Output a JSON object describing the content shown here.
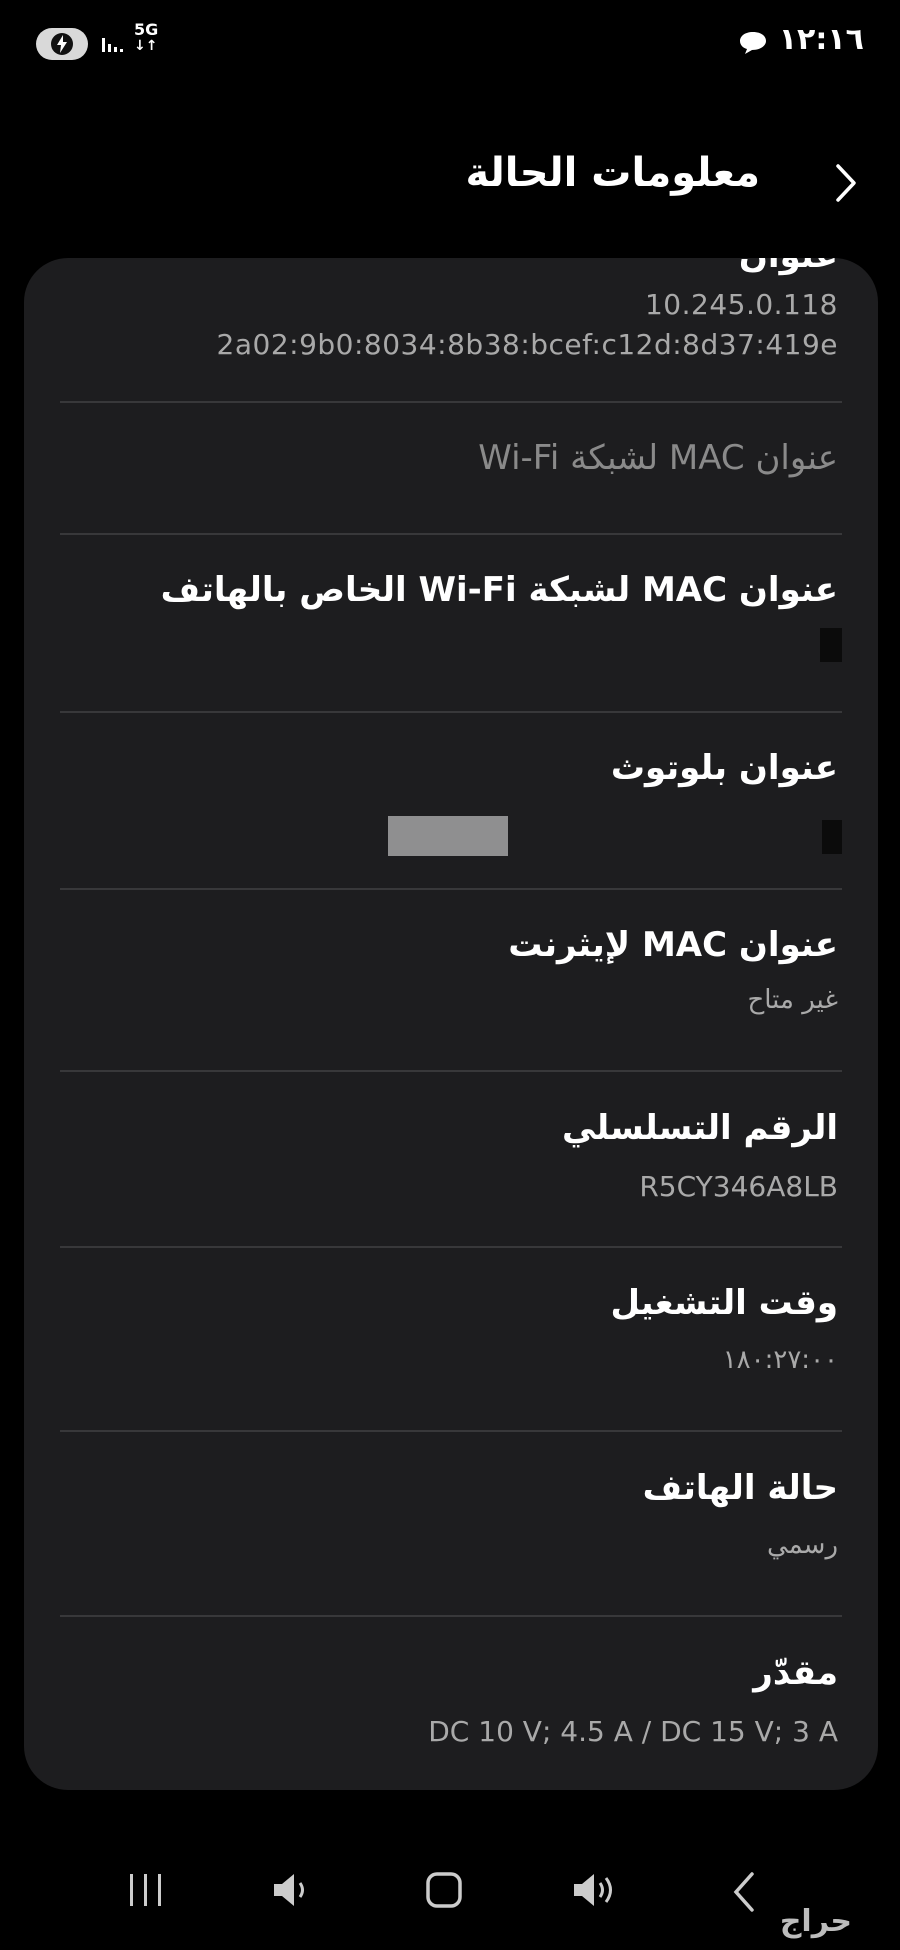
{
  "status_bar": {
    "time": "١٢:١٦",
    "network": "5G",
    "network_arrows": "↓↑",
    "battery_icon": "charging-battery-icon",
    "chat_icon": "chat-bubble-icon",
    "signal_icon": "signal-bars-icon"
  },
  "header": {
    "title": "معلومات الحالة",
    "back_icon": "chevron-right-icon"
  },
  "ip_section": {
    "label": "عنوان",
    "ipv4": "10.245.0.118",
    "ipv6": "2a02:9b0:8034:8b38:bcef:c12d:8d37:419e"
  },
  "items": [
    {
      "title": "عنوان MAC لشبكة Wi-Fi",
      "value": ""
    },
    {
      "title": "عنوان MAC لشبكة Wi-Fi الخاص بالهاتف",
      "value": ""
    },
    {
      "title": "عنوان بلوتوث",
      "value": ""
    },
    {
      "title": "عنوان MAC لإيثرنت",
      "value": "غير متاح"
    },
    {
      "title": "الرقم التسلسلي",
      "value": "R5CY346A8LB"
    },
    {
      "title": "وقت التشغيل",
      "value": "١٨٠:٢٧:٠٠"
    },
    {
      "title": "حالة الهاتف",
      "value": "رسمي"
    },
    {
      "title": "مقدّر",
      "value": "DC 10 V; 4.5 A / DC 15 V; 3 A"
    }
  ],
  "nav": {
    "recents_icon": "recent-apps-icon",
    "volume_down_icon": "volume-down-icon",
    "home_icon": "home-icon",
    "volume_up_icon": "volume-up-icon",
    "back_icon": "back-chevron-icon"
  },
  "watermark": "حراج"
}
